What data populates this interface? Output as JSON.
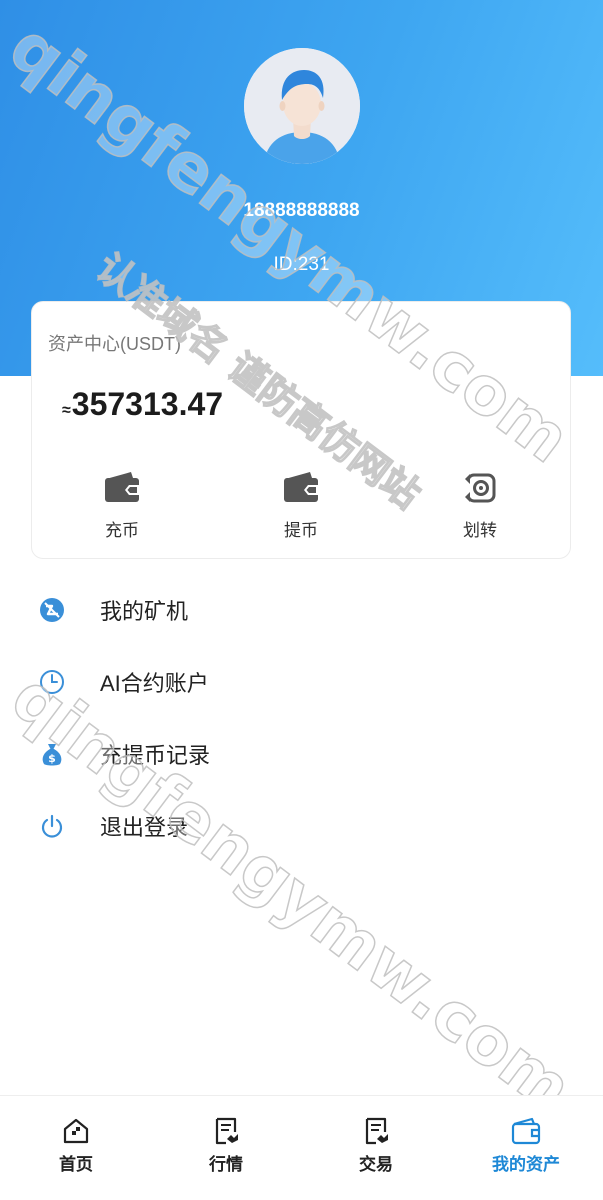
{
  "profile": {
    "phone": "18888888888",
    "id_text": "ID:231"
  },
  "assets": {
    "title": "资产中心(USDT)",
    "approx_symbol": "≈",
    "balance": "357313.47",
    "actions": [
      {
        "label": "充币",
        "icon": "wallet-icon"
      },
      {
        "label": "提币",
        "icon": "wallet-icon"
      },
      {
        "label": "划转",
        "icon": "transfer-icon"
      }
    ]
  },
  "menu": [
    {
      "label": "我的矿机",
      "icon": "mining-icon"
    },
    {
      "label": "AI合约账户",
      "icon": "clock-icon"
    },
    {
      "label": "充提币记录",
      "icon": "money-bag-icon"
    },
    {
      "label": "退出登录",
      "icon": "power-icon"
    }
  ],
  "tabs": [
    {
      "label": "首页",
      "icon": "home-icon",
      "active": false
    },
    {
      "label": "行情",
      "icon": "market-icon",
      "active": false
    },
    {
      "label": "交易",
      "icon": "trade-icon",
      "active": false
    },
    {
      "label": "我的资产",
      "icon": "wallet-icon",
      "active": true
    }
  ],
  "watermarks": {
    "domain": "qingfengymw.com",
    "slogan": "认准域名 谨防高仿网站"
  },
  "colors": {
    "header_gradient_start": "#2f8fe6",
    "header_gradient_end": "#55bdfb",
    "accent": "#1e88d6",
    "menu_icon": "#3a8fd8"
  }
}
